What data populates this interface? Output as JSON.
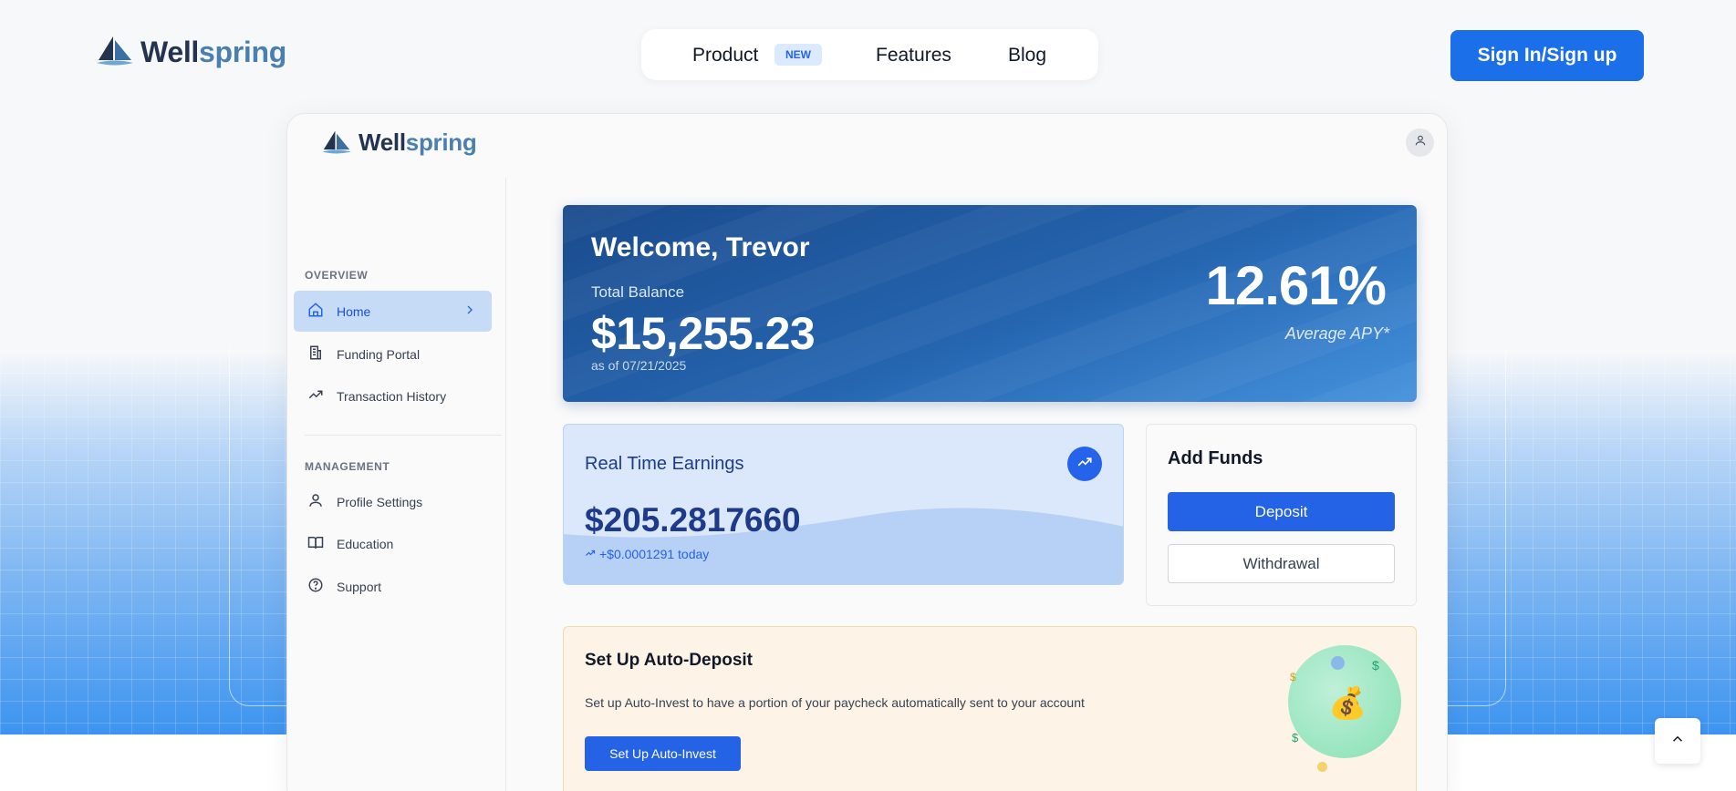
{
  "brand": {
    "name_part1": "Well",
    "name_part2": "spring",
    "logo_icon": "sailboat-icon"
  },
  "top_nav": {
    "items": [
      {
        "label": "Product",
        "badge": "NEW"
      },
      {
        "label": "Features"
      },
      {
        "label": "Blog"
      }
    ],
    "signin_label": "Sign In/Sign up"
  },
  "app": {
    "user_icon": "user-icon",
    "sidebar": {
      "sections": [
        {
          "title": "OVERVIEW",
          "items": [
            {
              "label": "Home",
              "icon": "home-icon",
              "active": true
            },
            {
              "label": "Funding Portal",
              "icon": "building-icon"
            },
            {
              "label": "Transaction History",
              "icon": "trending-up-icon"
            }
          ]
        },
        {
          "title": "MANAGEMENT",
          "items": [
            {
              "label": "Profile Settings",
              "icon": "user-icon"
            },
            {
              "label": "Education",
              "icon": "book-icon"
            },
            {
              "label": "Support",
              "icon": "help-circle-icon"
            }
          ]
        }
      ]
    },
    "hero": {
      "welcome": "Welcome, Trevor",
      "balance_label": "Total Balance",
      "balance": "$15,255.23",
      "as_of": "as of 07/21/2025",
      "apy": "12.61%",
      "apy_label": "Average APY*"
    },
    "earnings": {
      "title": "Real Time Earnings",
      "value": "$205.2817660",
      "today": "+$0.0001291 today"
    },
    "funds": {
      "title": "Add Funds",
      "deposit_label": "Deposit",
      "withdraw_label": "Withdrawal"
    },
    "auto_deposit": {
      "title": "Set Up Auto-Deposit",
      "description": "Set up Auto-Invest to have a portion of your paycheck automatically sent to your account",
      "button_label": "Set Up Auto-Invest",
      "art_emoji": "💰",
      "dollar_glyph": "$"
    }
  },
  "colors": {
    "primary": "#1b6fe8",
    "button_blue": "#2462e6",
    "hero_dark": "#1a4b8d",
    "hero_light": "#4592dd",
    "navy_text": "#1e3a8a"
  }
}
